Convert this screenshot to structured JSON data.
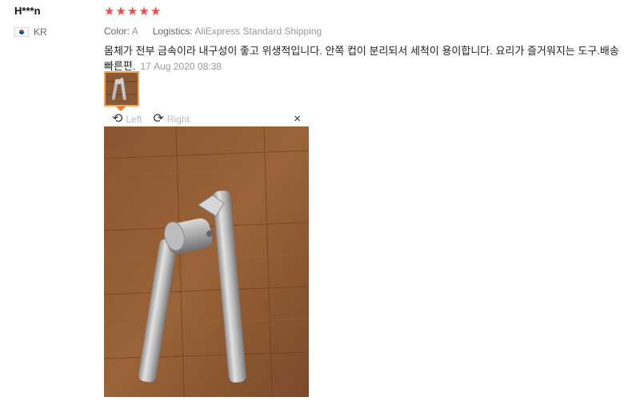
{
  "reviewer": {
    "name": "H***n",
    "country": "KR"
  },
  "review": {
    "rating": 5,
    "stars": [
      "★",
      "★",
      "★",
      "★",
      "★"
    ],
    "color_label": "Color:",
    "color_value": "A",
    "logistics_label": "Logistics:",
    "logistics_value": "AliExpress Standard Shipping",
    "text": "몸체가 전부 금속이라 내구성이 좋고 위생적입니다. 안쪽 컵이 분리되서 세척이 용이합니다. 요리가 즐거워지는 도구.배송 빠른편.",
    "date": "17 Aug 2020 08:38"
  },
  "viewer": {
    "rotate_left": "Left",
    "rotate_right": "Right",
    "close": "×"
  },
  "colors": {
    "star": "#f14a4a",
    "thumb_border": "#f0a453",
    "caret": "#f07b2b"
  },
  "icons": {
    "rotate_left": "rotate-left-icon",
    "rotate_right": "rotate-right-icon",
    "close": "close-icon"
  }
}
